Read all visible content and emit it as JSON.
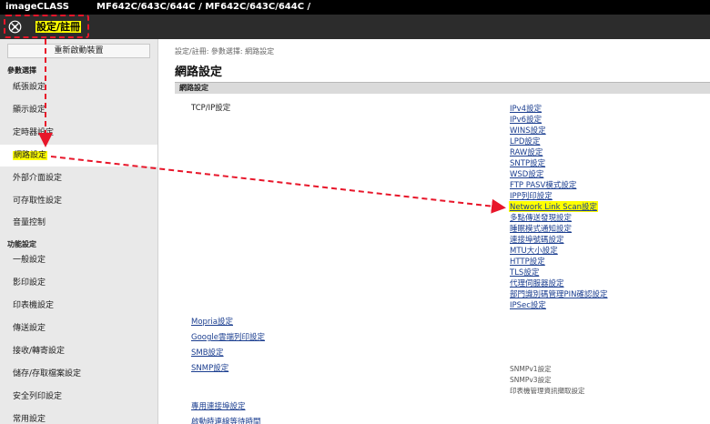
{
  "header": {
    "brand": "imageCLASS",
    "model": "MF642C/643C/644C / MF642C/643C/644C /"
  },
  "toolbar": {
    "settings_label": "設定/註冊"
  },
  "sidebar": {
    "reboot_label": "重新啟動裝置",
    "sections": {
      "preferences": "參數選擇",
      "functions": "功能設定"
    },
    "items": [
      {
        "label": "紙張設定"
      },
      {
        "label": "顯示設定"
      },
      {
        "label": "定時器設定"
      },
      {
        "label": "網路設定"
      },
      {
        "label": "外部介面設定"
      },
      {
        "label": "可存取性設定"
      },
      {
        "label": "音量控制"
      },
      {
        "label": "一般設定"
      },
      {
        "label": "影印設定"
      },
      {
        "label": "印表機設定"
      },
      {
        "label": "傳送設定"
      },
      {
        "label": "接收/轉寄設定"
      },
      {
        "label": "儲存/存取檔案設定"
      },
      {
        "label": "安全列印設定"
      },
      {
        "label": "常用設定"
      }
    ]
  },
  "main": {
    "breadcrumb": "設定/註冊: 參數選擇: 網路設定",
    "title": "網路設定",
    "section_header": "網路設定",
    "tcpip_label": "TCP/IP設定",
    "tcpip_links": [
      "IPv4設定",
      "IPv6設定",
      "WINS設定",
      "LPD設定",
      "RAW設定",
      "SNTP設定",
      "WSD設定",
      "FTP PASV模式設定",
      "IPP列印設定",
      "Network Link Scan設定",
      "多點傳送發現設定",
      "睡眠模式通知設定",
      "連接埠號碼設定",
      "MTU大小設定",
      "HTTP設定",
      "TLS設定",
      "代理伺服器設定",
      "部門識別碼管理PIN確認設定",
      "IPSec設定"
    ],
    "other_links": [
      "Mopria設定",
      "Google雲端列印設定",
      "SMB設定",
      "SNMP設定",
      "專用連接埠設定",
      "啟動時連線等待時間"
    ],
    "snmp_sub": [
      "SNMPv1設定",
      "SNMPv3設定",
      "印表機管理資訊擷取設定"
    ]
  },
  "colors": {
    "highlight": "#ffff00",
    "annotation": "#e8162a",
    "link": "#1a3d8f"
  }
}
